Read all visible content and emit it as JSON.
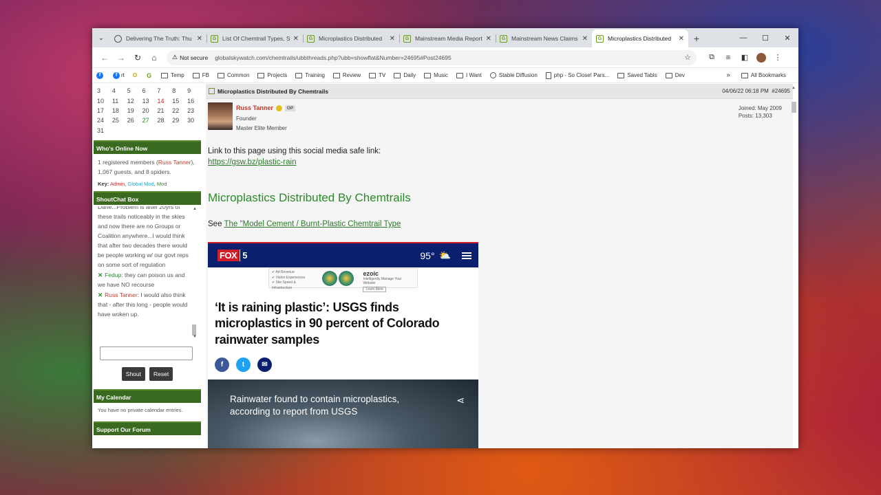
{
  "tabs": [
    {
      "title": "Delivering The Truth: Thu",
      "icon": "globe-icon"
    },
    {
      "title": "List Of Chemtrail Types, Sy",
      "icon": "gsw-icon"
    },
    {
      "title": "Microplastics Distributed",
      "icon": "gsw-icon"
    },
    {
      "title": "Mainstream Media Report",
      "icon": "gsw-icon"
    },
    {
      "title": "Mainstream News Claims",
      "icon": "gsw-icon"
    },
    {
      "title": "Microplastics Distributed",
      "icon": "gsw-icon",
      "active": true
    }
  ],
  "toolbar": {
    "security_label": "Not secure",
    "url": "globalskywatch.com/chemtrails/ubbthreads.php?ubb=showflat&Number=24695#Post24695"
  },
  "bookmarks": {
    "items": [
      "Temp",
      "FB",
      "Common",
      "Projects",
      "Training",
      "Review",
      "TV",
      "Daily",
      "Music",
      "I Want",
      "Stable Diffusion",
      "php - So Close! Pars...",
      "Saved Tabls",
      "Dev"
    ],
    "fb_label": "rt",
    "o_label": "O",
    "all": "All Bookmarks"
  },
  "calendar": {
    "rows": [
      [
        "3",
        "4",
        "5",
        "6",
        "7",
        "8",
        "9"
      ],
      [
        "10",
        "11",
        "12",
        "13",
        "14",
        "15",
        "16"
      ],
      [
        "17",
        "18",
        "19",
        "20",
        "21",
        "22",
        "23"
      ],
      [
        "24",
        "25",
        "26",
        "27",
        "28",
        "29",
        "30"
      ],
      [
        "31"
      ]
    ],
    "today": "14",
    "event_day": "27"
  },
  "whos_online": {
    "heading": "Who's Online Now",
    "prefix": "1 registered members (",
    "member": "Russ Tanner",
    "suffix": "), 1,067 guests, and 8 spiders.",
    "key_label": "Key:",
    "key_admin": "Admin",
    "key_gmod": "Global Mod",
    "key_mod": "Mod"
  },
  "shoutchat": {
    "heading": "ShoutChat Box",
    "messages": [
      {
        "name": "",
        "text": "Dane...Problem is after 20yrs of these trails noticeably in the skies and now there are no Groups or Coalition anywhere...I would think that after two decades there would be people working w/ our govt reps on some sort of regulation"
      },
      {
        "name": "Fedup",
        "text": ": they can poison us and we have NO recourse"
      },
      {
        "name": "Russ Tanner",
        "text": ": I would also think that - after this long - people would have woken up."
      }
    ],
    "shout_button": "Shout",
    "reset_button": "Reset"
  },
  "my_calendar": {
    "heading": "My Calendar",
    "note": "You have no private calendar entries."
  },
  "support": {
    "heading": "Support Our Forum"
  },
  "post": {
    "title": "Microplastics Distributed By Chemtrails",
    "date": "04/06/22 06:18 PM",
    "number": "#24695",
    "user": {
      "name": "Russ Tanner",
      "op_tag": "OP",
      "role": "Founder",
      "rank": "Master Elite Member",
      "joined": "Joined: May 2009",
      "posts": "Posts: 13,303"
    },
    "link_intro": "Link to this page using this social media safe link:",
    "link": "https://gsw.bz/plastic-rain",
    "heading": "Microplastics Distributed By Chemtrails",
    "see_prefix": "See ",
    "see_link": "The \"Model Cement / Burnt-Plastic Chemtrail Type"
  },
  "fox": {
    "logo_fox": "FOX",
    "logo_num": "5",
    "temp": "95°",
    "ad": {
      "items": [
        "Ad Revenue",
        "Visitor Experiences",
        "Site Speed & Infrastructure"
      ],
      "brand": "ezoic",
      "tagline": "Intelligently Manage Your Website",
      "cta": "Learn More"
    },
    "headline": "‘It is raining plastic’: USGS finds microplastics in 90 percent of Colorado rainwater samples",
    "video_title": "Rainwater found to contain microplastics, according to report from USGS"
  },
  "colors": {
    "sidebar_header": "#3a6a20",
    "link_green": "#2a7a2a",
    "fox_navy": "#0a1f6e",
    "fox_red": "#d01f2a"
  }
}
